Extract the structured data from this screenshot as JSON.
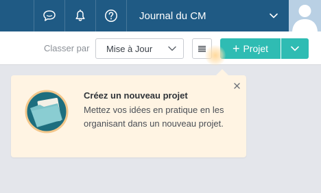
{
  "header": {
    "journal_label": "Journal du CM",
    "icons": [
      "chat-icon",
      "bell-icon",
      "help-icon",
      "chevron-down-icon",
      "avatar"
    ]
  },
  "toolbar": {
    "sort_label": "Classer par",
    "sort_value": "Mise à Jour",
    "new_project_label": "Projet",
    "icons": [
      "chevron-down-icon",
      "list-icon",
      "plus-icon"
    ]
  },
  "coachmark": {
    "title": "Créez un nouveau projet",
    "body": "Mettez vos idées en pratique en les organisant dans un nouveau projet.",
    "icons": [
      "close-icon",
      "folder-illustration"
    ]
  },
  "colors": {
    "header_bg": "#1f5a84",
    "accent": "#2fbcb3",
    "page_bg": "#e4e6eb",
    "tip_bg": "#fff4e3"
  }
}
